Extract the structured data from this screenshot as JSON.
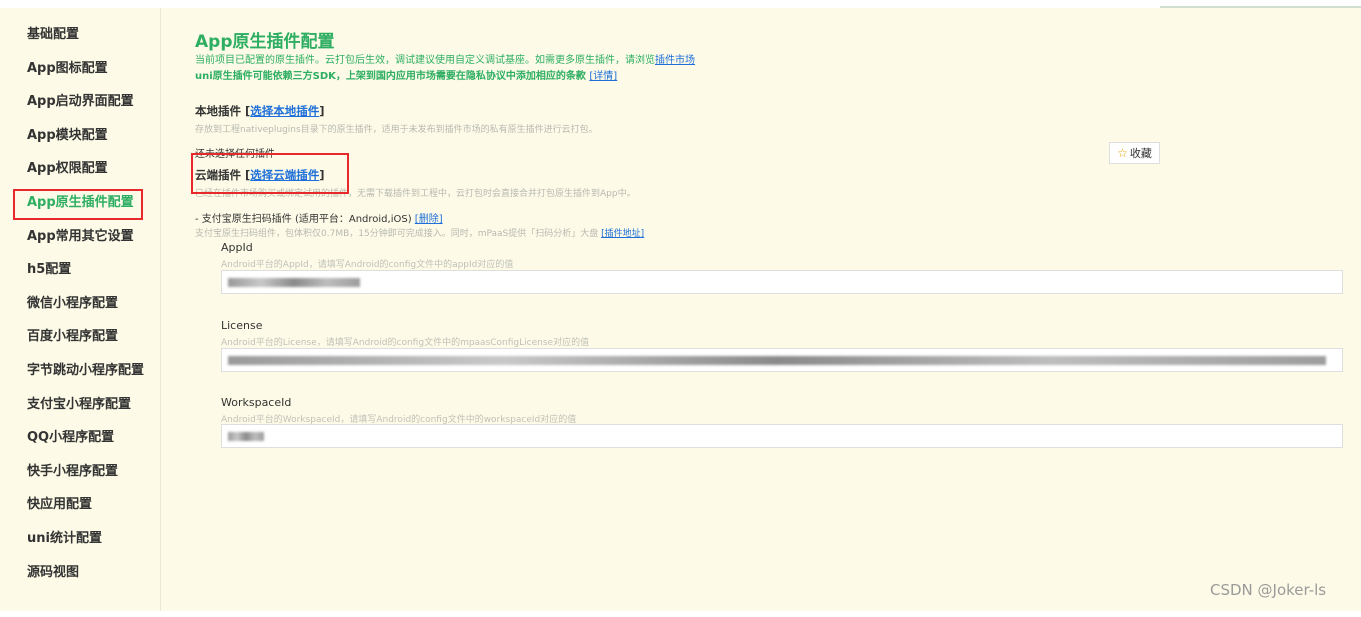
{
  "sidebar": {
    "items": [
      {
        "label": "基础配置"
      },
      {
        "label": "App图标配置"
      },
      {
        "label": "App启动界面配置"
      },
      {
        "label": "App模块配置"
      },
      {
        "label": "App权限配置"
      },
      {
        "label": "App原生插件配置",
        "active": true
      },
      {
        "label": "App常用其它设置"
      },
      {
        "label": "h5配置"
      },
      {
        "label": "微信小程序配置"
      },
      {
        "label": "百度小程序配置"
      },
      {
        "label": "字节跳动小程序配置"
      },
      {
        "label": "支付宝小程序配置"
      },
      {
        "label": "QQ小程序配置"
      },
      {
        "label": "快手小程序配置"
      },
      {
        "label": "快应用配置"
      },
      {
        "label": "uni统计配置"
      },
      {
        "label": "源码视图"
      }
    ]
  },
  "main": {
    "title": "App原生插件配置",
    "desc1_text": "当前项目已配置的原生插件。云打包后生效，调试建议使用自定义调试基座。如需更多原生插件，请浏览",
    "desc1_link": "插件市场",
    "desc2_text": "uni原生插件可能依赖三方SDK，上架到国内应用市场需要在隐私协议中添加相应的条款",
    "desc2_link": "[详情]",
    "local": {
      "title": "本地插件",
      "open": "[",
      "link": "选择本地插件",
      "close": "]",
      "hint": "存放到工程nativeplugins目录下的原生插件，适用于未发布到插件市场的私有原生插件进行云打包。",
      "empty": "还未选择任何插件"
    },
    "cloud": {
      "title": "云端插件",
      "open": "[",
      "link": "选择云端插件",
      "close": "]",
      "hint": "已经在插件市场购买或绑定试用的插件，无需下载插件到工程中，云打包时会直接合并打包原生插件到App中。"
    },
    "plugin": {
      "name": "- 支付宝原生扫码插件 (适用平台：Android,iOS)",
      "delete": "[删除]",
      "desc": "支付宝原生扫码组件，包体积仅0.7MB，15分钟即可完成接入。同时，mPaaS提供「扫码分析」大盘",
      "link": "[插件地址]"
    },
    "fields": [
      {
        "label": "AppId",
        "hint": "Android平台的AppId，请填写Android的config文件中的appId对应的值"
      },
      {
        "label": "License",
        "hint": "Android平台的License，请填写Android的config文件中的mpaasConfigLicense对应的值"
      },
      {
        "label": "WorkspaceId",
        "hint": "Android平台的WorkspaceId，请填写Android的config文件中的workspaceId对应的值"
      }
    ]
  },
  "favorite": {
    "label": "收藏",
    "icon": "star-icon"
  },
  "watermark": "CSDN @Joker-ls",
  "colors": {
    "accent": "#2dae62",
    "highlight": "#e8292b",
    "link": "#1e6fd9"
  }
}
